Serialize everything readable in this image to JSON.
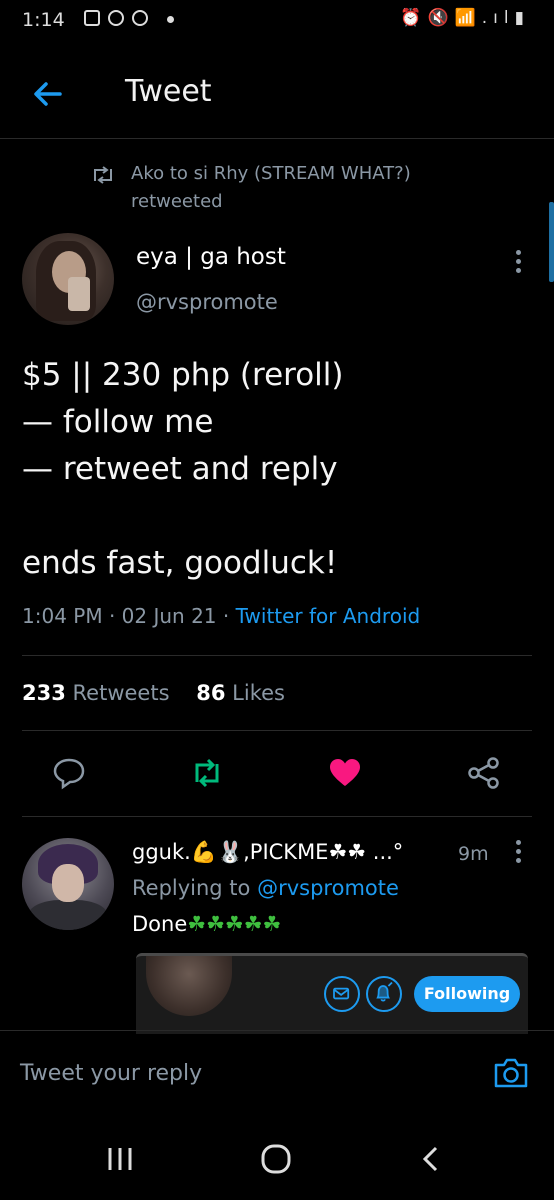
{
  "status_bar": {
    "time": "1:14",
    "right_icons": "⏰🔇📶.ıl▮"
  },
  "header": {
    "title": "Tweet"
  },
  "retweet": {
    "text": "Ako to si Rhy (STREAM WHAT?) retweeted"
  },
  "tweet": {
    "author_name": "eya | ga host",
    "author_handle": "@rvspromote",
    "lines": [
      "$5 || 230 php (reroll)",
      "— follow me",
      "— retweet and reply",
      "",
      "ends fast, goodluck!"
    ],
    "time": "1:04 PM",
    "date": "02 Jun 21",
    "source": "Twitter for Android",
    "retweets_count": "233",
    "retweets_label": "Retweets",
    "likes_count": "86",
    "likes_label": "Likes",
    "liked": true
  },
  "reply": {
    "name": "gguk.💪🐰,PICKME☘☘ ...°",
    "time": "9m",
    "replying_to_label": "Replying to",
    "replying_to_handle": "@rvspromote",
    "text": "Done",
    "clovers": "☘☘☘☘☘"
  },
  "follow_button": {
    "label": "Following"
  },
  "compose": {
    "placeholder": "Tweet your reply"
  },
  "colors": {
    "accent": "#1d9bf0",
    "like": "#f91880",
    "retweet": "#00ba7c",
    "muted": "#8b98a5"
  }
}
